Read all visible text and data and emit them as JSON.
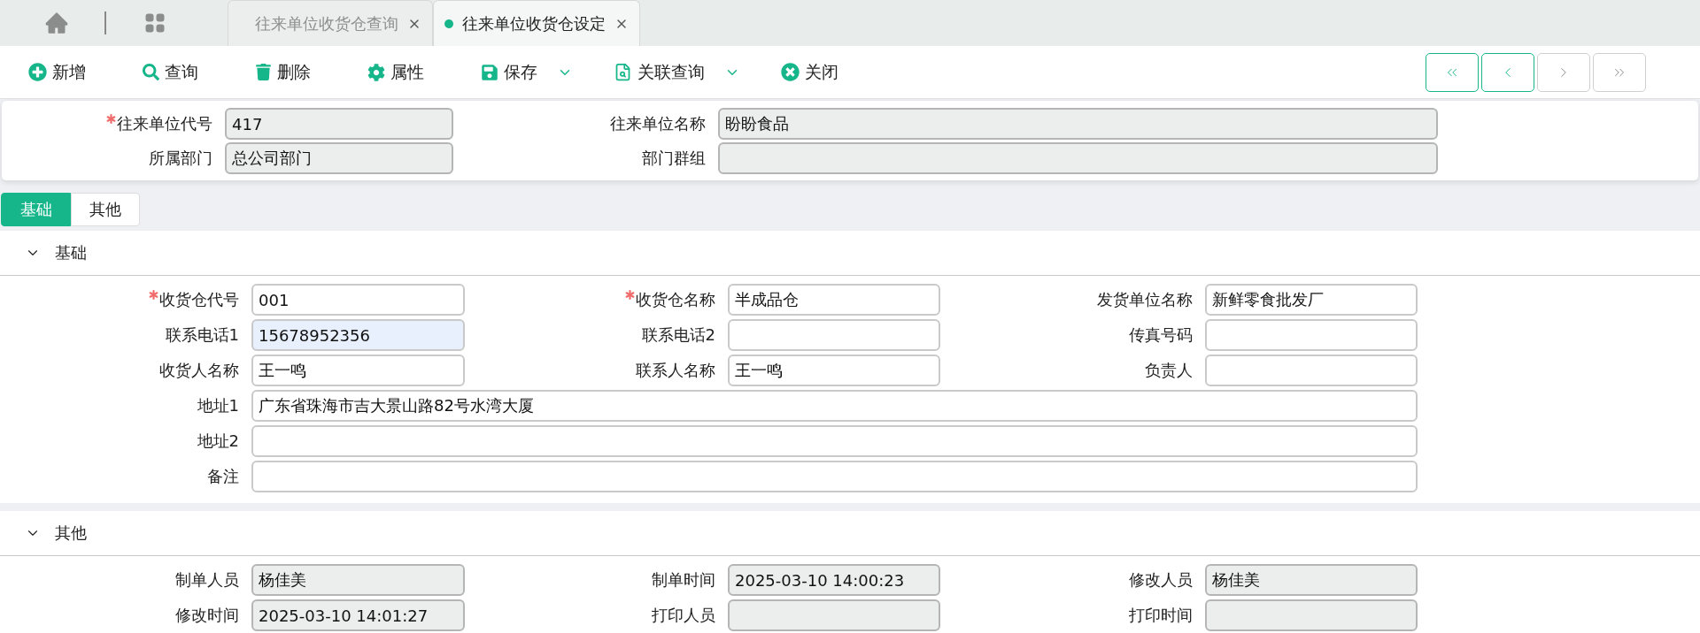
{
  "top_tabs": [
    {
      "label": "往来单位收货仓查询",
      "selected": false
    },
    {
      "label": "往来单位收货仓设定",
      "selected": true
    }
  ],
  "toolbar": [
    {
      "kind": "add",
      "label": "新增",
      "dropdown": false
    },
    {
      "kind": "search",
      "label": "查询",
      "dropdown": false
    },
    {
      "kind": "delete",
      "label": "删除",
      "dropdown": false
    },
    {
      "kind": "properties",
      "label": "属性",
      "dropdown": false
    },
    {
      "kind": "save",
      "label": "保存",
      "dropdown": true
    },
    {
      "kind": "related",
      "label": "关联查询",
      "dropdown": true
    },
    {
      "kind": "close",
      "label": "关闭",
      "dropdown": false
    }
  ],
  "pager": [
    {
      "kind": "first",
      "disabled": false
    },
    {
      "kind": "previous",
      "disabled": false
    },
    {
      "kind": "next",
      "disabled": true
    },
    {
      "kind": "last",
      "disabled": true
    }
  ],
  "header_fields": [
    {
      "label": "往来单位代号",
      "value": "417",
      "required": true,
      "disabled": true
    },
    {
      "label": "往来单位名称",
      "value": "盼盼食品",
      "required": false,
      "disabled": true
    },
    {
      "label": "所属部门",
      "value": "总公司部门",
      "required": false,
      "disabled": true
    },
    {
      "label": "部门群组",
      "required": false,
      "disabled": true
    }
  ],
  "form_tabs": [
    {
      "label": "基础",
      "selected": true
    },
    {
      "label": "其他",
      "selected": false
    }
  ],
  "sections": [
    {
      "title": "基础",
      "expanded": true,
      "fields": [
        {
          "label": "收货仓代号",
          "value": "001",
          "required": true,
          "disabled": false,
          "autofilled": false,
          "wide": false
        },
        {
          "label": "收货仓名称",
          "value": "半成品仓",
          "required": true,
          "disabled": false,
          "autofilled": false,
          "wide": false
        },
        {
          "label": "发货单位名称",
          "value": "新鲜零食批发厂",
          "required": false,
          "disabled": false,
          "autofilled": false,
          "wide": false
        },
        {
          "label": "联系电话1",
          "value": "15678952356",
          "required": false,
          "disabled": false,
          "autofilled": true,
          "wide": false
        },
        {
          "label": "联系电话2",
          "required": false,
          "disabled": false,
          "autofilled": false,
          "wide": false
        },
        {
          "label": "传真号码",
          "required": false,
          "disabled": false,
          "autofilled": false,
          "wide": false
        },
        {
          "label": "收货人名称",
          "value": "王一鸣",
          "required": false,
          "disabled": false,
          "autofilled": false,
          "wide": false
        },
        {
          "label": "联系人名称",
          "value": "王一鸣",
          "required": false,
          "disabled": false,
          "autofilled": false,
          "wide": false
        },
        {
          "label": "负责人",
          "required": false,
          "disabled": false,
          "autofilled": false,
          "wide": false
        },
        {
          "label": "地址1",
          "value": "广东省珠海市吉大景山路82号水湾大厦",
          "required": false,
          "disabled": false,
          "autofilled": false,
          "wide": true
        },
        {
          "label": "地址2",
          "required": false,
          "disabled": false,
          "autofilled": false,
          "wide": true
        },
        {
          "label": "备注",
          "required": false,
          "disabled": false,
          "autofilled": false,
          "wide": true
        }
      ]
    },
    {
      "title": "其他",
      "expanded": true,
      "fields": [
        {
          "label": "制单人员",
          "value": "杨佳美",
          "required": false,
          "disabled": true,
          "autofilled": false,
          "wide": false
        },
        {
          "label": "制单时间",
          "value": "2025-03-10 14:00:23",
          "required": false,
          "disabled": true,
          "autofilled": false,
          "wide": false
        },
        {
          "label": "修改人员",
          "value": "杨佳美",
          "required": false,
          "disabled": true,
          "autofilled": false,
          "wide": false
        },
        {
          "label": "修改时间",
          "value": "2025-03-10 14:01:27",
          "required": false,
          "disabled": true,
          "autofilled": false,
          "wide": false
        },
        {
          "label": "打印人员",
          "required": false,
          "disabled": true,
          "autofilled": false,
          "wide": false
        },
        {
          "label": "打印时间",
          "required": false,
          "disabled": true,
          "autofilled": false,
          "wide": false
        }
      ]
    }
  ]
}
